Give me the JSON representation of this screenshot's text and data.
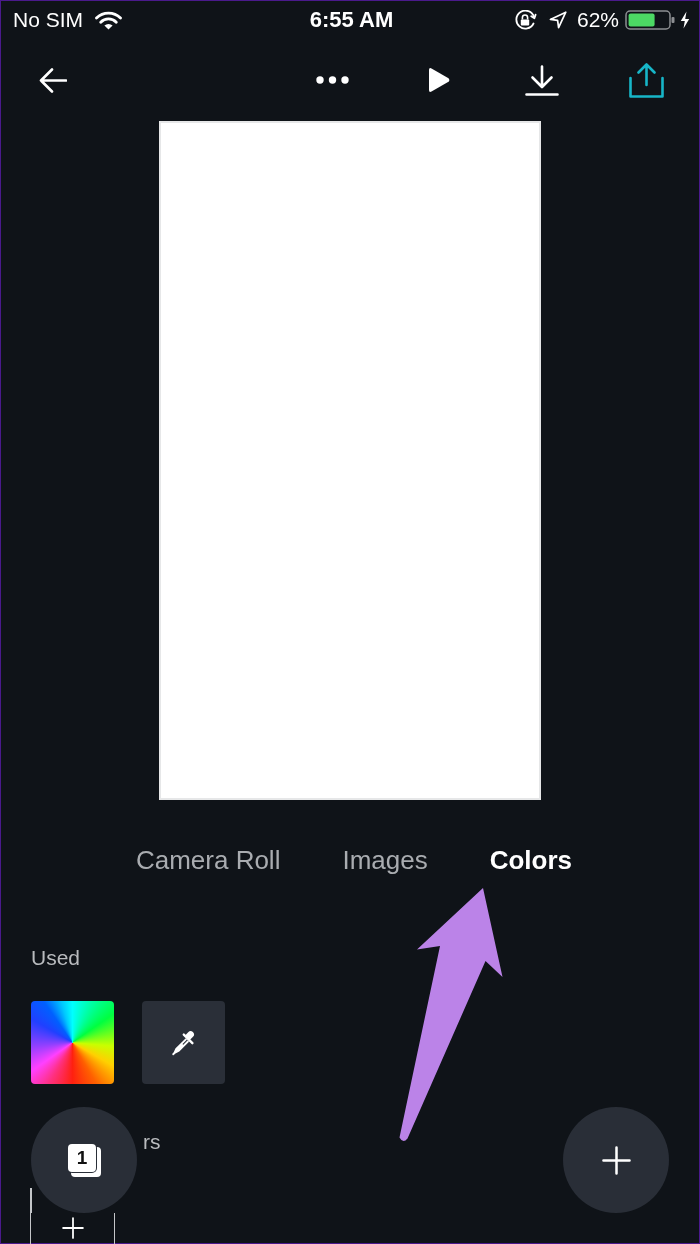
{
  "status_bar": {
    "carrier": "No SIM",
    "time": "6:55 AM",
    "battery": "62%"
  },
  "toolbar": [
    {
      "kind": "back"
    },
    {
      "kind": "more"
    },
    {
      "kind": "play"
    },
    {
      "kind": "download"
    },
    {
      "kind": "share"
    }
  ],
  "tabs": [
    {
      "label": "Camera Roll",
      "selected": false
    },
    {
      "label": "Images",
      "selected": false
    },
    {
      "label": "Colors",
      "selected": true
    }
  ],
  "used_section": {
    "title": "Used",
    "swatches": [
      {
        "kind": "color_wheel"
      },
      {
        "kind": "eyedropper"
      }
    ]
  },
  "section_2": {
    "title": "rs",
    "tiles": [
      {
        "kind": "add"
      }
    ]
  },
  "page_button": {
    "count": "1"
  }
}
